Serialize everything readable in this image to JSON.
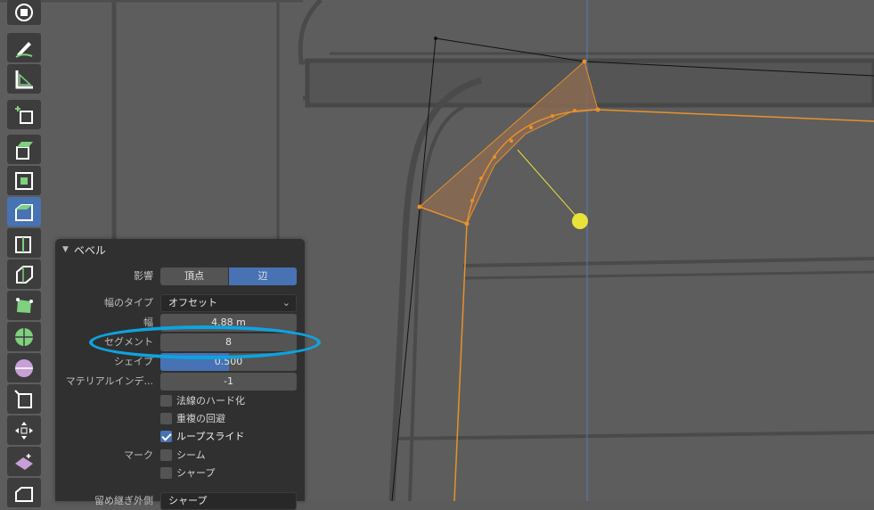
{
  "colors": {
    "accent": "#4772b3",
    "selection_orange": "#e8912b",
    "highlight_blue": "#0ea3e0",
    "pivot_yellow": "#e8e23a"
  },
  "toolbar": {
    "tools": [
      {
        "icon": "cursor-transform-icon"
      },
      {
        "icon": "annotate-icon"
      },
      {
        "icon": "measure-icon"
      },
      {
        "icon": "add-cube-icon"
      },
      {
        "icon": "extrude-icon"
      },
      {
        "icon": "inset-faces-icon"
      },
      {
        "icon": "bevel-icon",
        "active": true
      },
      {
        "icon": "loop-cut-icon"
      },
      {
        "icon": "knife-icon"
      },
      {
        "icon": "poly-build-icon"
      },
      {
        "icon": "spin-icon"
      },
      {
        "icon": "smooth-icon"
      },
      {
        "icon": "shrink-fatten-icon"
      },
      {
        "icon": "edge-slide-icon"
      },
      {
        "icon": "shear-icon"
      },
      {
        "icon": "rip-region-icon"
      }
    ]
  },
  "panel": {
    "title": "ベベル",
    "affect": {
      "label": "影響",
      "options": [
        "頂点",
        "辺"
      ],
      "selected": "辺"
    },
    "width_type": {
      "label": "幅のタイプ",
      "value": "オフセット"
    },
    "width": {
      "label": "幅",
      "value": "4.88 m"
    },
    "segments": {
      "label": "セグメント",
      "value": "8"
    },
    "shape": {
      "label": "シェイプ",
      "value": "0.500",
      "fraction": 0.5
    },
    "material_index": {
      "label": "マテリアルインデ...",
      "value": "-1"
    },
    "harden_normals": {
      "label": "法線のハード化",
      "checked": false
    },
    "clamp_overlap": {
      "label": "重複の回避",
      "checked": false
    },
    "loop_slide": {
      "label": "ループスライド",
      "checked": true
    },
    "mark": {
      "label": "マーク",
      "seam": {
        "label": "シーム",
        "checked": false
      },
      "sharp": {
        "label": "シャープ",
        "checked": false
      }
    },
    "miter_outer": {
      "label": "留め継ぎ外側",
      "value": "シャープ"
    }
  }
}
